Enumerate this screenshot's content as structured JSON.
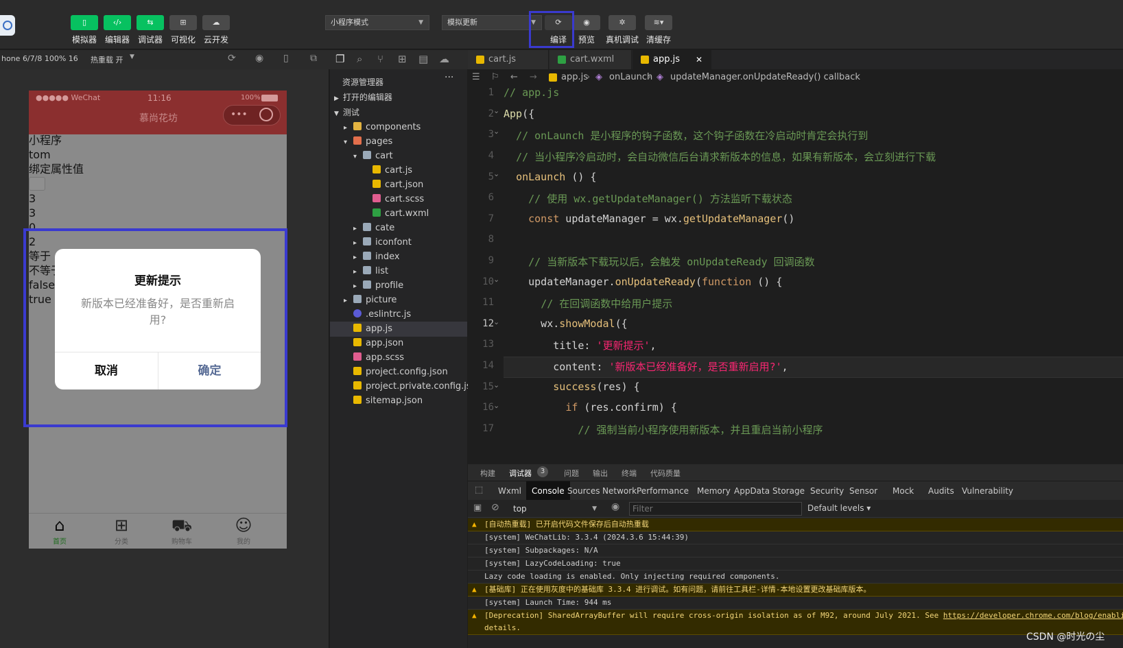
{
  "toolbar": {
    "buttons": [
      {
        "label": "模拟器"
      },
      {
        "label": "编辑器"
      },
      {
        "label": "调试器"
      },
      {
        "label": "可视化"
      },
      {
        "label": "云开发"
      }
    ],
    "mode_select": "小程序模式",
    "compile_select": "模拟更新",
    "actions": [
      {
        "label": "编译"
      },
      {
        "label": "预览"
      },
      {
        "label": "真机调试"
      },
      {
        "label": "清缓存"
      }
    ]
  },
  "simulator": {
    "device": "hone 6/7/8 100% 16",
    "hot_reload": "热重载 开",
    "status_carrier": "●●●●● WeChat",
    "status_time": "11:16",
    "status_battery": "100%",
    "nav_title": "慕尚花坊",
    "page_lines": [
      "小程序",
      "tom",
      "绑定属性值",
      "",
      "3",
      "3",
      "0",
      "2",
      "等于",
      "不等于",
      "false",
      "true"
    ],
    "modal": {
      "title": "更新提示",
      "content": "新版本已经准备好，是否重新启用?",
      "cancel": "取消",
      "confirm": "确定"
    },
    "tabbar": [
      "首页",
      "分类",
      "购物车",
      "我的"
    ]
  },
  "explorer": {
    "title": "资源管理器",
    "more": "···",
    "open_editors": "打开的编辑器",
    "project": "测试",
    "tree": [
      {
        "label": "components",
        "type": "folder-y",
        "depth": 1,
        "arrow": "▸"
      },
      {
        "label": "pages",
        "type": "folder-r",
        "depth": 1,
        "arrow": "▾"
      },
      {
        "label": "cart",
        "type": "folder",
        "depth": 2,
        "arrow": "▾"
      },
      {
        "label": "cart.js",
        "type": "js",
        "depth": 3,
        "arrow": ""
      },
      {
        "label": "cart.json",
        "type": "json",
        "depth": 3,
        "arrow": ""
      },
      {
        "label": "cart.scss",
        "type": "scss",
        "depth": 3,
        "arrow": ""
      },
      {
        "label": "cart.wxml",
        "type": "wxml",
        "depth": 3,
        "arrow": ""
      },
      {
        "label": "cate",
        "type": "folder",
        "depth": 2,
        "arrow": "▸"
      },
      {
        "label": "iconfont",
        "type": "folder",
        "depth": 2,
        "arrow": "▸"
      },
      {
        "label": "index",
        "type": "folder",
        "depth": 2,
        "arrow": "▸"
      },
      {
        "label": "list",
        "type": "folder",
        "depth": 2,
        "arrow": "▸"
      },
      {
        "label": "profile",
        "type": "folder",
        "depth": 2,
        "arrow": "▸"
      },
      {
        "label": "picture",
        "type": "folder",
        "depth": 1,
        "arrow": "▸"
      },
      {
        "label": ".eslintrc.js",
        "type": "eslint",
        "depth": 1,
        "arrow": ""
      },
      {
        "label": "app.js",
        "type": "js",
        "depth": 1,
        "arrow": "",
        "selected": true
      },
      {
        "label": "app.json",
        "type": "json",
        "depth": 1,
        "arrow": ""
      },
      {
        "label": "app.scss",
        "type": "scss",
        "depth": 1,
        "arrow": ""
      },
      {
        "label": "project.config.json",
        "type": "json",
        "depth": 1,
        "arrow": ""
      },
      {
        "label": "project.private.config.js...",
        "type": "json",
        "depth": 1,
        "arrow": ""
      },
      {
        "label": "sitemap.json",
        "type": "json",
        "depth": 1,
        "arrow": ""
      }
    ]
  },
  "editor": {
    "tabs": [
      {
        "label": "cart.js",
        "icon": "js"
      },
      {
        "label": "cart.wxml",
        "icon": "wxml"
      },
      {
        "label": "app.js",
        "icon": "js",
        "active": true
      }
    ],
    "close": "✕",
    "breadcrumb": [
      "app.js",
      "onLaunch",
      "updateManager.onUpdateReady() callback"
    ],
    "current_line": 12,
    "line_numbers": [
      "1",
      "2",
      "3",
      "4",
      "5",
      "6",
      "7",
      "8",
      "9",
      "10",
      "11",
      "12",
      "13",
      "14",
      "15",
      "16",
      "17"
    ]
  },
  "panel": {
    "tabs": [
      "构建",
      "调试器",
      "问题",
      "输出",
      "终端",
      "代码质量"
    ],
    "debugger_badge": "3",
    "devtools_tabs": [
      "Wxml",
      "Console",
      "Sources",
      "Network",
      "Performance",
      "Memory",
      "AppData",
      "Storage",
      "Security",
      "Sensor",
      "Mock",
      "Audits",
      "Vulnerability"
    ],
    "context": "top",
    "filter_placeholder": "Filter",
    "levels": "Default levels ▾",
    "logs": [
      {
        "text": "[自动热重载] 已开启代码文件保存后自动热重载",
        "warn": true
      },
      {
        "text": "[system] WeChatLib: 3.3.4 (2024.3.6 15:44:39)",
        "warn": false
      },
      {
        "text": "[system] Subpackages: N/A",
        "warn": false
      },
      {
        "text": "[system] LazyCodeLoading: true",
        "warn": false
      },
      {
        "text": "Lazy code loading is enabled. Only injecting required components.",
        "warn": false
      },
      {
        "text": "[基础库] 正在使用灰度中的基础库 3.3.4 进行调试。如有问题，请前往工具栏-详情-本地设置更改基础库版本。",
        "warn": true
      },
      {
        "text": "[system] Launch Time: 944 ms",
        "warn": false
      },
      {
        "text": "[Deprecation] SharedArrayBuffer will require cross-origin isolation as of M92, around July 2021. See ",
        "link": "https://developer.chrome.com/blog/enabli",
        "text2": "details.",
        "warn": true
      }
    ]
  },
  "watermark": "CSDN @时光の尘",
  "icons": [
    "phone-icon",
    "code-icon",
    "debug-icon",
    "visual-icon",
    "cloud-icon",
    "refresh-icon",
    "eye-icon",
    "bug-icon",
    "layers-icon",
    "home-icon",
    "grid-icon",
    "cart-icon",
    "smile-icon",
    "files-icon",
    "search-icon",
    "branch-icon",
    "extensions-icon",
    "warning-icon"
  ]
}
